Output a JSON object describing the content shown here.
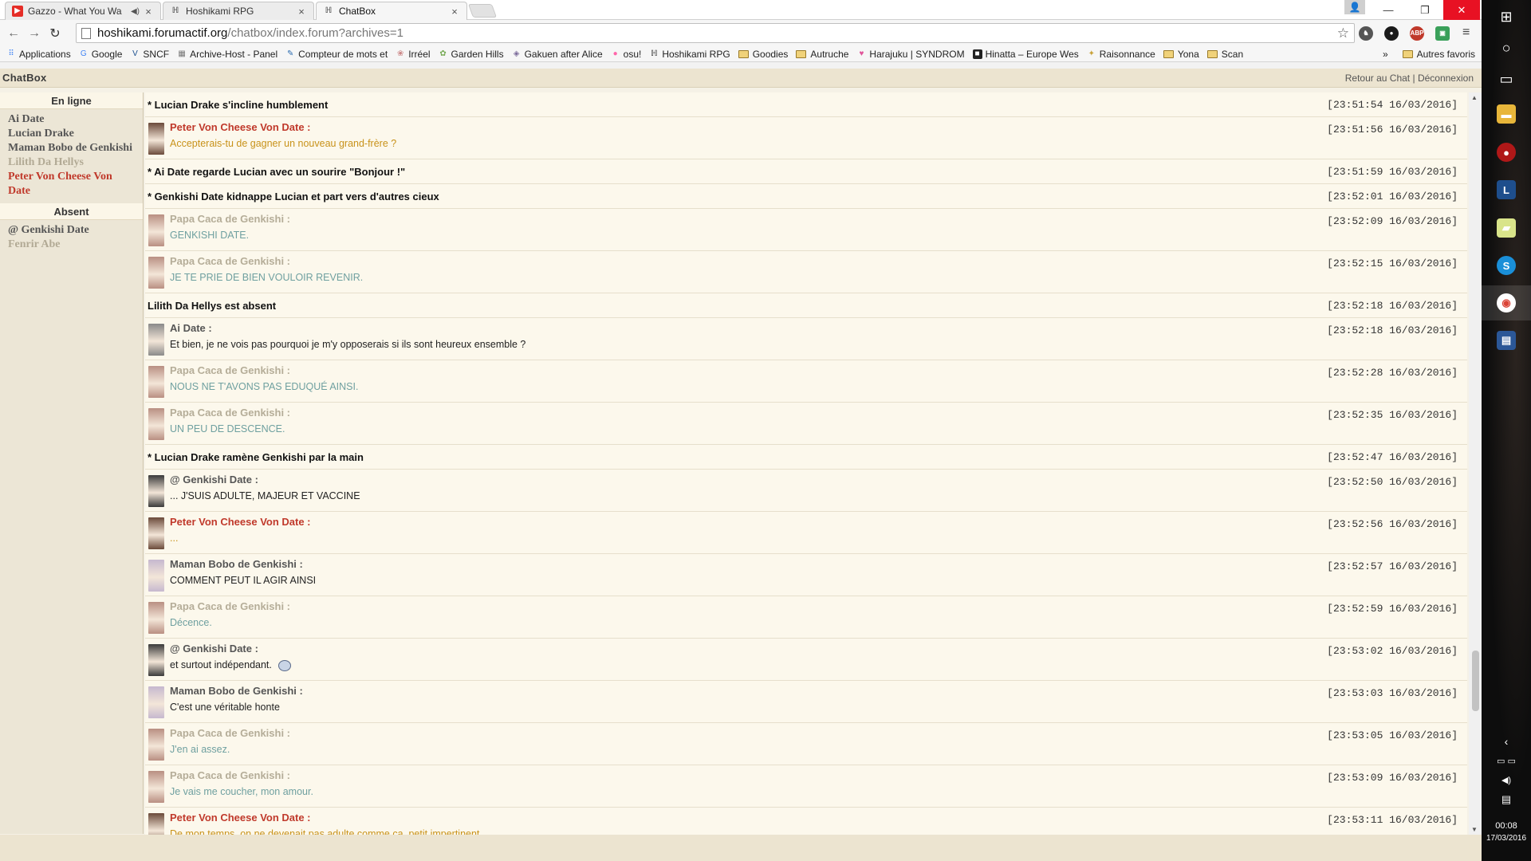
{
  "browser": {
    "tabs": [
      {
        "title": "Gazzo - What You Wa",
        "icon": "youtube-icon",
        "active": false
      },
      {
        "title": "Hoshikami RPG",
        "icon": "hk-icon",
        "active": false
      },
      {
        "title": "ChatBox",
        "icon": "hk-icon",
        "active": true
      }
    ],
    "url_host": "hoshikami.forumactif.org",
    "url_path": "/chatbox/index.forum?archives=1",
    "bookmarks": [
      {
        "label": "Applications",
        "icon": "apps-icon"
      },
      {
        "label": "Google",
        "icon": "google-icon"
      },
      {
        "label": "SNCF",
        "icon": "sncf-icon"
      },
      {
        "label": "Archive-Host - Panel",
        "icon": "archive-icon"
      },
      {
        "label": "Compteur de mots et",
        "icon": "pen-icon"
      },
      {
        "label": "Irréel",
        "icon": "irreel-icon"
      },
      {
        "label": "Garden Hills",
        "icon": "garden-icon"
      },
      {
        "label": "Gakuen after Alice",
        "icon": "gakuen-icon"
      },
      {
        "label": "osu!",
        "icon": "osu-icon"
      },
      {
        "label": "Hoshikami RPG",
        "icon": "hk-icon"
      },
      {
        "label": "Goodies",
        "icon": "folder-icon"
      },
      {
        "label": "Autruche",
        "icon": "folder-icon"
      },
      {
        "label": "Harajuku | SYNDROM",
        "icon": "heart-icon"
      },
      {
        "label": "Hinatta – Europe Wes",
        "icon": "hinatta-icon"
      },
      {
        "label": "Raisonnance",
        "icon": "raisonnance-icon"
      },
      {
        "label": "Yona",
        "icon": "folder-icon"
      },
      {
        "label": "Scan",
        "icon": "folder-icon"
      }
    ],
    "bookmarks_more": "»",
    "bookmarks_other": "Autres favoris"
  },
  "chatbox": {
    "title": "ChatBox",
    "link_back": "Retour au Chat",
    "link_sep": " | ",
    "link_logout": "Déconnexion",
    "online_header": "En ligne",
    "absent_header": "Absent",
    "online_users": [
      {
        "name": "Ai Date",
        "color": "#555555"
      },
      {
        "name": "Lucian Drake",
        "color": "#555555"
      },
      {
        "name": "Maman Bobo de Genkishi",
        "color": "#555555"
      },
      {
        "name": "Lilith Da Hellys",
        "color": "#b2aa95"
      },
      {
        "name": "Peter Von Cheese Von Date",
        "color": "#c0392b"
      }
    ],
    "absent_users": [
      {
        "name": "@ Genkishi Date",
        "color": "#555555"
      },
      {
        "name": "Fenrir Abe",
        "color": "#b2aa95"
      }
    ],
    "messages": [
      {
        "type": "action",
        "text": "* Lucian Drake s'incline humblement",
        "time": "[23:51:54 16/03/2016]"
      },
      {
        "type": "msg",
        "author": "Peter Von Cheese Von Date :",
        "author_color": "#c0392b",
        "text": "Accepterais-tu de gagner un nouveau grand-frère ?",
        "text_color": "#c8921a",
        "time": "[23:51:56 16/03/2016]",
        "avatar": "#6b4a3a"
      },
      {
        "type": "action",
        "text": "* Ai Date regarde Lucian avec un sourire \"Bonjour !\"",
        "time": "[23:51:59 16/03/2016]"
      },
      {
        "type": "action",
        "text": "* Genkishi Date kidnappe Lucian et part vers d'autres cieux",
        "time": "[23:52:01 16/03/2016]"
      },
      {
        "type": "msg",
        "author": "Papa Caca de Genkishi :",
        "author_color": "#b5ad98",
        "text": "GENKISHI DATE.",
        "text_color": "#6fa0a0",
        "time": "[23:52:09 16/03/2016]",
        "avatar": "#b98f82"
      },
      {
        "type": "msg",
        "author": "Papa Caca de Genkishi :",
        "author_color": "#b5ad98",
        "text": "JE TE PRIE DE BIEN VOULOIR REVENIR.",
        "text_color": "#6fa0a0",
        "time": "[23:52:15 16/03/2016]",
        "avatar": "#b98f82"
      },
      {
        "type": "status",
        "text": "Lilith Da Hellys est absent",
        "time": "[23:52:18 16/03/2016]"
      },
      {
        "type": "msg",
        "author": "Ai Date :",
        "author_color": "#555555",
        "text": "Et bien, je ne vois pas pourquoi je m'y opposerais si ils sont heureux ensemble ?",
        "text_color": "#222222",
        "time": "[23:52:18 16/03/2016]",
        "avatar": "#8a8a8a"
      },
      {
        "type": "msg",
        "author": "Papa Caca de Genkishi :",
        "author_color": "#b5ad98",
        "text": "NOUS NE T'AVONS PAS EDUQUÉ AINSI.",
        "text_color": "#6fa0a0",
        "time": "[23:52:28 16/03/2016]",
        "avatar": "#b98f82"
      },
      {
        "type": "msg",
        "author": "Papa Caca de Genkishi :",
        "author_color": "#b5ad98",
        "text": "UN PEU DE DESCENCE.",
        "text_color": "#6fa0a0",
        "time": "[23:52:35 16/03/2016]",
        "avatar": "#b98f82"
      },
      {
        "type": "action",
        "text": "* Lucian Drake ramène Genkishi par la main",
        "time": "[23:52:47 16/03/2016]"
      },
      {
        "type": "msg",
        "author": "@ Genkishi Date :",
        "author_color": "#555555",
        "text": "... J'SUIS ADULTE, MAJEUR ET VACCINE",
        "text_color": "#222222",
        "time": "[23:52:50 16/03/2016]",
        "avatar": "#3a3a3a"
      },
      {
        "type": "msg",
        "author": "Peter Von Cheese Von Date :",
        "author_color": "#c0392b",
        "text": "...",
        "text_color": "#c8921a",
        "time": "[23:52:56 16/03/2016]",
        "avatar": "#6b4a3a"
      },
      {
        "type": "msg",
        "author": "Maman Bobo de Genkishi :",
        "author_color": "#555555",
        "text": "COMMENT PEUT IL AGIR AINSI",
        "text_color": "#222222",
        "time": "[23:52:57 16/03/2016]",
        "avatar": "#c6b8cf"
      },
      {
        "type": "msg",
        "author": "Papa Caca de Genkishi :",
        "author_color": "#b5ad98",
        "text": "Décence.",
        "text_color": "#6fa0a0",
        "time": "[23:52:59 16/03/2016]",
        "avatar": "#b98f82"
      },
      {
        "type": "msg",
        "author": "@ Genkishi Date :",
        "author_color": "#555555",
        "text": "et surtout indépendant.",
        "text_color": "#222222",
        "time": "[23:53:02 16/03/2016]",
        "avatar": "#3a3a3a",
        "emote": true
      },
      {
        "type": "msg",
        "author": "Maman Bobo de Genkishi :",
        "author_color": "#555555",
        "text": "C'est une véritable honte",
        "text_color": "#222222",
        "time": "[23:53:03 16/03/2016]",
        "avatar": "#c6b8cf"
      },
      {
        "type": "msg",
        "author": "Papa Caca de Genkishi :",
        "author_color": "#b5ad98",
        "text": "J'en ai assez.",
        "text_color": "#6fa0a0",
        "time": "[23:53:05 16/03/2016]",
        "avatar": "#b98f82"
      },
      {
        "type": "msg",
        "author": "Papa Caca de Genkishi :",
        "author_color": "#b5ad98",
        "text": "Je vais me coucher, mon amour.",
        "text_color": "#6fa0a0",
        "time": "[23:53:09 16/03/2016]",
        "avatar": "#b98f82"
      },
      {
        "type": "msg",
        "author": "Peter Von Cheese Von Date :",
        "author_color": "#c0392b",
        "text": "De mon temps, on ne devenait pas adulte comme ça, petit impertinent",
        "text_color": "#c8921a",
        "time": "[23:53:11 16/03/2016]",
        "avatar": "#6b4a3a"
      }
    ]
  },
  "taskbar": {
    "clock_time": "00:08",
    "clock_date": "17/03/2016"
  }
}
